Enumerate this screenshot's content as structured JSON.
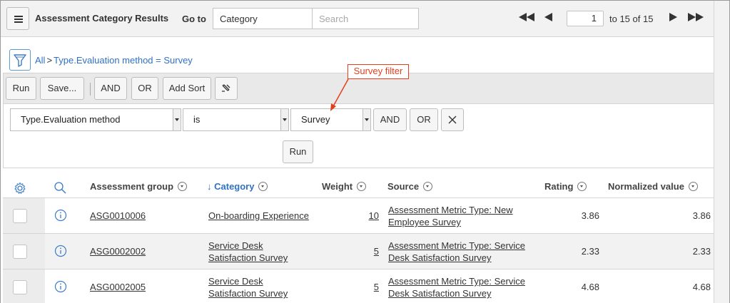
{
  "header": {
    "title": "Assessment Category Results",
    "goto_label": "Go to",
    "goto_field": "Category",
    "search_placeholder": "Search",
    "pagination": {
      "current_page": "1",
      "range_text": "to 15 of 15"
    }
  },
  "breadcrumb": {
    "all_label": "All",
    "separator": ">",
    "condition": "Type.Evaluation method = Survey"
  },
  "builder": {
    "toolbar": {
      "run": "Run",
      "save": "Save...",
      "and": "AND",
      "or": "OR",
      "add_sort": "Add Sort"
    },
    "condition": {
      "field": "Type.Evaluation method",
      "operator": "is",
      "value": "Survey",
      "and": "AND",
      "or": "OR"
    },
    "run": "Run"
  },
  "annotation": {
    "label": "Survey filter",
    "color": "#e2401c"
  },
  "table": {
    "columns": {
      "group": "Assessment group",
      "category": "Category",
      "weight": "Weight",
      "source": "Source",
      "rating": "Rating",
      "normalized": "Normalized value"
    },
    "sort_indicator": "↓",
    "rows": [
      {
        "group": "ASG0010006",
        "category_1": "On-boarding Experience",
        "category_2": "",
        "weight": "10",
        "source_1": "Assessment Metric Type: New",
        "source_2": "Employee Survey",
        "rating": "3.86",
        "normalized": "3.86"
      },
      {
        "group": "ASG0002002",
        "category_1": "Service Desk",
        "category_2": "Satisfaction Survey",
        "weight": "5",
        "source_1": "Assessment Metric Type: Service",
        "source_2": "Desk Satisfaction Survey",
        "rating": "2.33",
        "normalized": "2.33"
      },
      {
        "group": "ASG0002005",
        "category_1": "Service Desk",
        "category_2": "Satisfaction Survey",
        "weight": "5",
        "source_1": "Assessment Metric Type: Service",
        "source_2": "Desk Satisfaction Survey",
        "rating": "4.68",
        "normalized": "4.68"
      }
    ]
  },
  "colors": {
    "link": "#2f72c4",
    "accent": "#5d9ad6"
  }
}
